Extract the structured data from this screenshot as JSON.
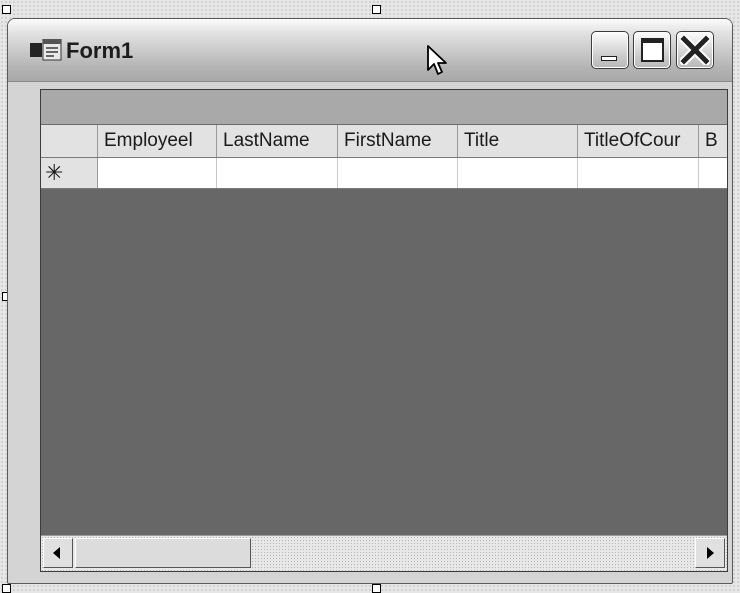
{
  "window": {
    "title": "Form1",
    "icons": {
      "app": "form-app-icon",
      "minimize": "minimize-icon",
      "maximize": "maximize-icon",
      "close": "close-icon",
      "cursor": "mouse-pointer-icon"
    }
  },
  "grid": {
    "columns": [
      "Employeel",
      "LastName",
      "FirstName",
      "Title",
      "TitleOfCour",
      "B"
    ],
    "new_row_marker": "✳",
    "scrollbar": {
      "left_icon": "scroll-left-arrow-icon",
      "right_icon": "scroll-right-arrow-icon"
    }
  },
  "colors": {
    "grid_background": "#676767",
    "caption_bar": "#a9a9a9",
    "header_background": "#e2e2e2"
  }
}
